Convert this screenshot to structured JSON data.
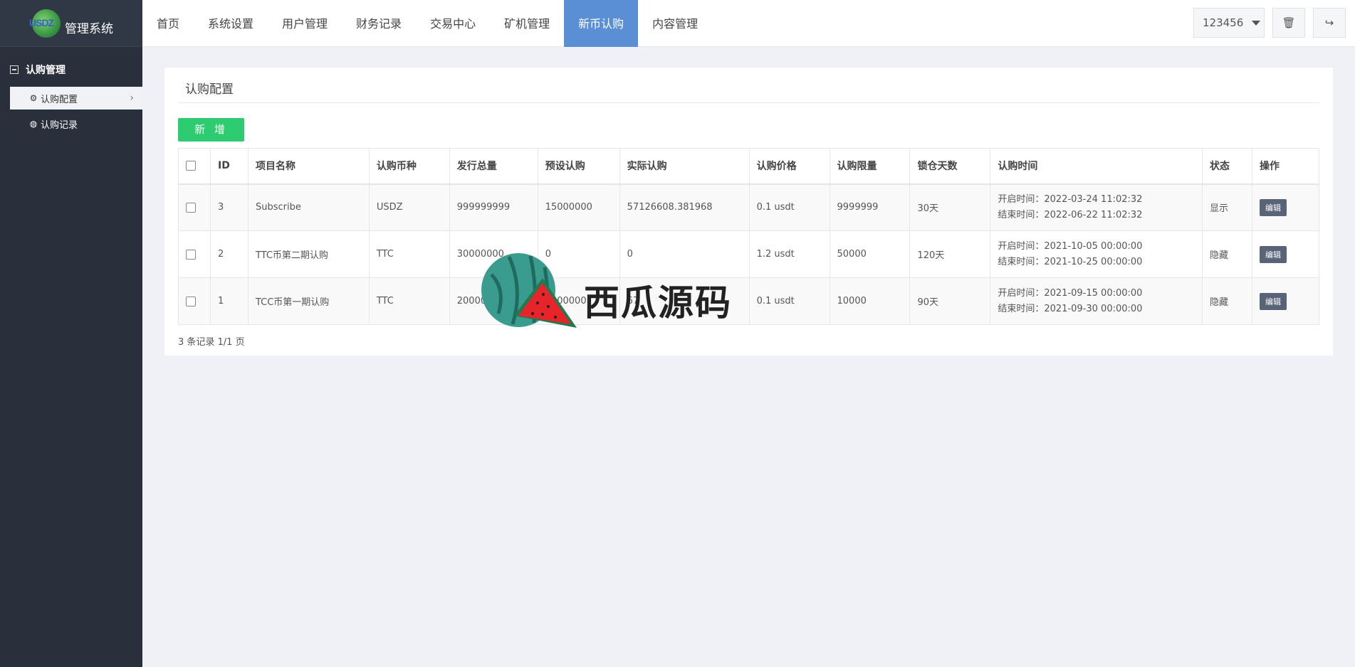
{
  "app": {
    "logo_letters": "USDZ",
    "logo_text": "管理系统"
  },
  "sidebar": {
    "group_label": "认购管理",
    "items": [
      {
        "label": "认购配置",
        "icon": "gear-icon",
        "active": true
      },
      {
        "label": "认购记录",
        "icon": "globe-icon",
        "active": false
      }
    ]
  },
  "nav": {
    "items": [
      "首页",
      "系统设置",
      "用户管理",
      "财务记录",
      "交易中心",
      "矿机管理",
      "新币认购",
      "内容管理"
    ],
    "active": "新币认购"
  },
  "header": {
    "user": "123456"
  },
  "page": {
    "title": "认购配置",
    "add_label": "新 增",
    "columns": [
      "ID",
      "项目名称",
      "认购币种",
      "发行总量",
      "预设认购",
      "实际认购",
      "认购价格",
      "认购限量",
      "锁仓天数",
      "认购时间",
      "状态",
      "操作"
    ],
    "rows": [
      {
        "id": "3",
        "name": "Subscribe",
        "coin": "USDZ",
        "total": "999999999",
        "preset": "15000000",
        "actual": "57126608.381968",
        "price": "0.1 usdt",
        "limit": "9999999",
        "lock_days": "30天",
        "start": "开启时间：2022-03-24 11:02:32",
        "end": "结束时间：2022-06-22 11:02:32",
        "status": "显示",
        "action": "编辑"
      },
      {
        "id": "2",
        "name": "TTC币第二期认购",
        "coin": "TTC",
        "total": "30000000",
        "preset": "0",
        "actual": "0",
        "price": "1.2 usdt",
        "limit": "50000",
        "lock_days": "120天",
        "start": "开启时间：2021-10-05 00:00:00",
        "end": "结束时间：2021-10-25 00:00:00",
        "status": "隐藏",
        "action": "编辑"
      },
      {
        "id": "1",
        "name": "TCC币第一期认购",
        "coin": "TTC",
        "total": "20000",
        "preset": "0000000",
        "actual": "67",
        "price": "0.1 usdt",
        "limit": "10000",
        "lock_days": "90天",
        "start": "开启时间：2021-09-15 00:00:00",
        "end": "结束时间：2021-09-30 00:00:00",
        "status": "隐藏",
        "action": "编辑"
      }
    ],
    "footer": "3 条记录 1/1 页"
  },
  "watermark": {
    "text": "西瓜源码"
  }
}
